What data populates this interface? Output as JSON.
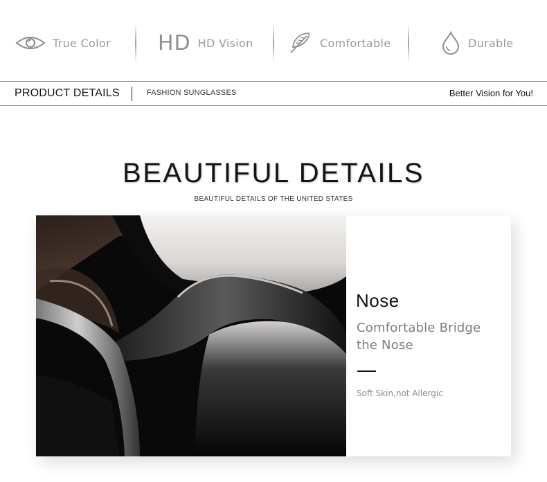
{
  "features": [
    {
      "icon": "eye-icon",
      "label": "True Color"
    },
    {
      "icon": "hd-icon",
      "mark": "HD",
      "label": "HD Vision"
    },
    {
      "icon": "feather-icon",
      "label": "Comfortable"
    },
    {
      "icon": "water-drop-icon",
      "label": "Durable"
    }
  ],
  "product_bar": {
    "title": "PRODUCT DETAILS",
    "subtitle": "FASHION SUNGLASSES",
    "tagline": "Better Vision for You!"
  },
  "section": {
    "title": "BEAUTIFUL DETAILS",
    "subtitle": "BEAUTIFUL DETAILS OF THE UNITED STATES"
  },
  "detail_card": {
    "heading": "Nose",
    "description": "Comfortable Bridge the Nose",
    "note": "Soft Skin,not Allergic"
  }
}
